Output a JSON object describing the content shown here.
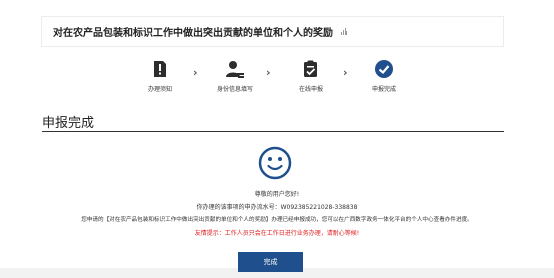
{
  "header": {
    "title": "对在农产品包装和标识工作中做出突出贡献的单位和个人的奖励"
  },
  "steps": [
    {
      "label": "办理须知",
      "icon": "notice-icon"
    },
    {
      "label": "身份信息填写",
      "icon": "user-edit-icon"
    },
    {
      "label": "在线申报",
      "icon": "clipboard-check-icon"
    },
    {
      "label": "申报完成",
      "icon": "check-circle-icon"
    }
  ],
  "section": {
    "title": "申报完成"
  },
  "result": {
    "greeting": "尊敬的用户您好!",
    "flow_number": "你办理的该事项的申办流水号：W092385221028-338838",
    "description": "您申请的【对在农产品包装和标识工作中做出突出贡献的单位和个人的奖励】办理已经申报成功，您可以在广西数字政务一体化平台的个人中心查看办件进度。",
    "warning": "友情提示：工作人员只会在工作日进行业务办理，请耐心等候!"
  },
  "actions": {
    "done_label": "完成"
  },
  "colors": {
    "accent": "#1f4f8c",
    "step_icon": "#2d2d2d",
    "warning": "#e02020"
  }
}
